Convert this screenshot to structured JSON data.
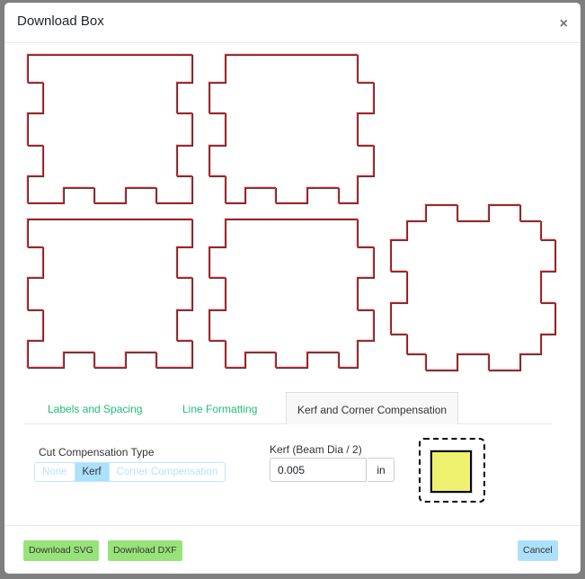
{
  "dialog": {
    "title": "Download Box",
    "close_label": "×"
  },
  "tabs": [
    {
      "label": "Labels and Spacing",
      "active": false
    },
    {
      "label": "Line Formatting",
      "active": false
    },
    {
      "label": "Kerf and Corner Compensation",
      "active": true
    }
  ],
  "kerf_panel": {
    "cut_compensation_label": "Cut Compensation Type",
    "options": [
      "None",
      "Kerf",
      "Corner Compensation"
    ],
    "selected": "Kerf",
    "kerf_label": "Kerf (Beam Dia / 2)",
    "kerf_value": "0.005",
    "kerf_unit": "in",
    "preview_fill": "#eff26f"
  },
  "footer": {
    "download_svg": "Download SVG",
    "download_dxf": "Download DXF",
    "cancel": "Cancel"
  },
  "colors": {
    "tab_link": "#1ec07a",
    "download_button": "#97e37a",
    "cancel_button": "#ace0fb",
    "cut_line": "#e8262a",
    "kerf_line": "#333333"
  }
}
